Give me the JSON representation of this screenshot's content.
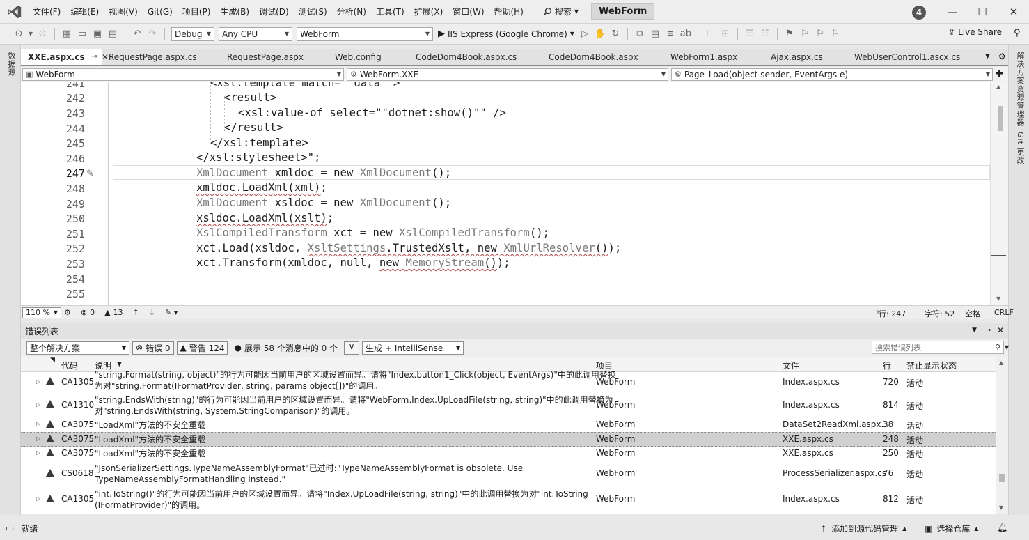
{
  "menu": {
    "items": [
      "文件(F)",
      "编辑(E)",
      "视图(V)",
      "Git(G)",
      "项目(P)",
      "生成(B)",
      "调试(D)",
      "测试(S)",
      "分析(N)",
      "工具(T)",
      "扩展(X)",
      "窗口(W)",
      "帮助(H)"
    ],
    "search_label": "搜索",
    "solution_name": "WebForm",
    "notification_count": "4"
  },
  "toolbar": {
    "config": "Debug",
    "platform": "Any CPU",
    "startup_project": "WebForm",
    "run_label": "IIS Express (Google Chrome)",
    "live_share": "Live Share"
  },
  "side_labels": {
    "left": "数据源",
    "right_top": "解决方案资源管理器",
    "right_bottom": "Git 更改"
  },
  "doc_tabs": [
    {
      "label": "XXE.aspx.cs",
      "active": true
    },
    {
      "label": "RequestPage.aspx.cs",
      "active": false
    },
    {
      "label": "RequestPage.aspx",
      "active": false
    },
    {
      "label": "Web.config",
      "active": false
    },
    {
      "label": "CodeDom4Book.aspx.cs",
      "active": false
    },
    {
      "label": "CodeDom4Book.aspx",
      "active": false
    },
    {
      "label": "WebForm1.aspx",
      "active": false
    },
    {
      "label": "Ajax.aspx.cs",
      "active": false
    },
    {
      "label": "WebUserControl1.ascx.cs",
      "active": false
    }
  ],
  "nav": {
    "project": "WebForm",
    "type": "WebForm.XXE",
    "member": "Page_Load(object sender, EventArgs e)"
  },
  "code": {
    "line_numbers": [
      "241",
      "242",
      "243",
      "244",
      "245",
      "246",
      "247",
      "248",
      "249",
      "250",
      "251",
      "252",
      "253",
      "254",
      "255"
    ],
    "current_line": "247"
  },
  "editor_status": {
    "zoom": "110 %",
    "errors": "0",
    "warnings": "13",
    "line": "行: 247",
    "col": "字符: 52",
    "whitespace": "空格",
    "eol": "CRLF"
  },
  "error_list": {
    "title": "错误列表",
    "scope": "整个解决方案",
    "errors_btn": "错误 0",
    "warnings_btn": "警告 124",
    "messages_btn": "展示 58 个消息中的 0 个",
    "build_filter": "生成 + IntelliSense",
    "search_placeholder": "搜索错误列表",
    "headers": {
      "code": "代码",
      "desc": "说明",
      "project": "项目",
      "file": "文件",
      "line": "行",
      "suppress": "禁止显示状态"
    },
    "rows": [
      {
        "code": "CA1305",
        "desc1": "\"string.Format(string, object)\"的行为可能因当前用户的区域设置而异。请将\"Index.button1_Click(object, EventArgs)\"中的此调用替换",
        "desc2": "为对\"string.Format(IFormatProvider, string, params object[])\"的调用。",
        "project": "WebForm",
        "file": "Index.aspx.cs",
        "line": "720",
        "state": "活动"
      },
      {
        "code": "CA1310",
        "desc1": "\"string.EndsWith(string)\"的行为可能因当前用户的区域设置而异。请将\"WebForm.Index.UpLoadFile(string, string)\"中的此调用替换为",
        "desc2": "对\"string.EndsWith(string, System.StringComparison)\"的调用。",
        "project": "WebForm",
        "file": "Index.aspx.cs",
        "line": "814",
        "state": "活动"
      },
      {
        "code": "CA3075",
        "desc1": "\"LoadXml\"方法的不安全重载",
        "desc2": "",
        "project": "WebForm",
        "file": "DataSet2ReadXml.aspx....",
        "line": "38",
        "state": "活动"
      },
      {
        "code": "CA3075",
        "desc1": "\"LoadXml\"方法的不安全重载",
        "desc2": "",
        "project": "WebForm",
        "file": "XXE.aspx.cs",
        "line": "248",
        "state": "活动"
      },
      {
        "code": "CA3075",
        "desc1": "\"LoadXml\"方法的不安全重载",
        "desc2": "",
        "project": "WebForm",
        "file": "XXE.aspx.cs",
        "line": "250",
        "state": "活动"
      },
      {
        "code": "CS0618",
        "desc1": "\"JsonSerializerSettings.TypeNameAssemblyFormat\"已过时:\"TypeNameAssemblyFormat is obsolete. Use",
        "desc2": "TypeNameAssemblyFormatHandling instead.\"",
        "project": "WebForm",
        "file": "ProcessSerializer.aspx.cs",
        "line": "76",
        "state": "活动"
      },
      {
        "code": "CA1305",
        "desc1": "\"int.ToString()\"的行为可能因当前用户的区域设置而异。请将\"Index.UpLoadFile(string, string)\"中的此调用替换为对\"int.ToString",
        "desc2": "(IFormatProvider)\"的调用。",
        "project": "WebForm",
        "file": "Index.aspx.cs",
        "line": "812",
        "state": "活动"
      }
    ]
  },
  "statusbar": {
    "ready": "就绪",
    "add_source": "添加到源代码管理",
    "select_repo": "选择仓库"
  }
}
